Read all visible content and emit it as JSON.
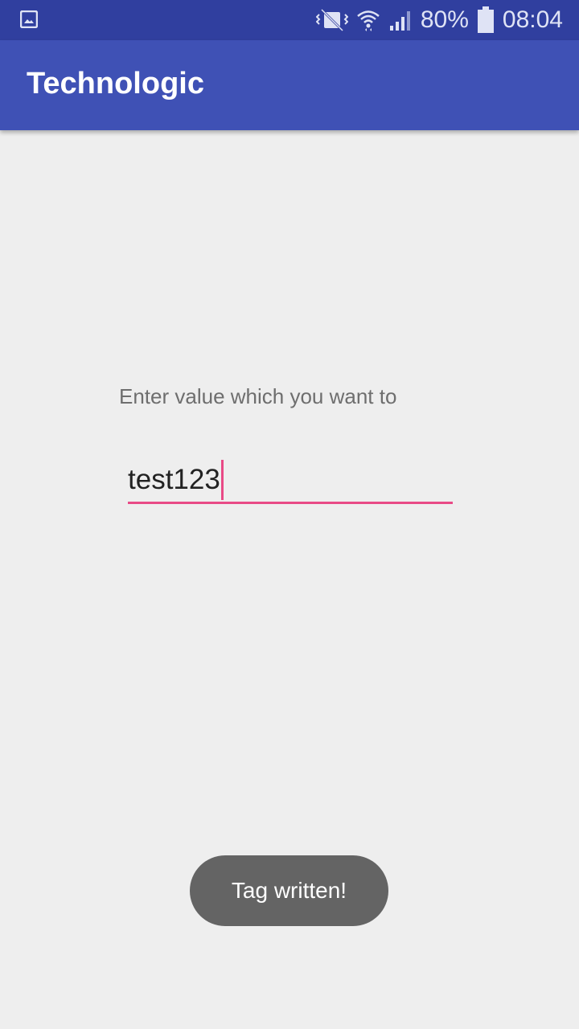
{
  "status_bar": {
    "icons": [
      "gallery-icon",
      "vibrate-icon",
      "wifi-icon",
      "signal-icon",
      "battery-icon"
    ],
    "battery_percent": "80%",
    "time": "08:04"
  },
  "app_bar": {
    "title": "Technologic"
  },
  "form": {
    "label": "Enter value which you want to",
    "input_value": "test123"
  },
  "toast": {
    "message": "Tag written!"
  },
  "colors": {
    "status_bar": "#303f9f",
    "app_bar": "#3f51b5",
    "accent": "#e84a86",
    "background": "#eeeeee",
    "toast": "#646464"
  }
}
